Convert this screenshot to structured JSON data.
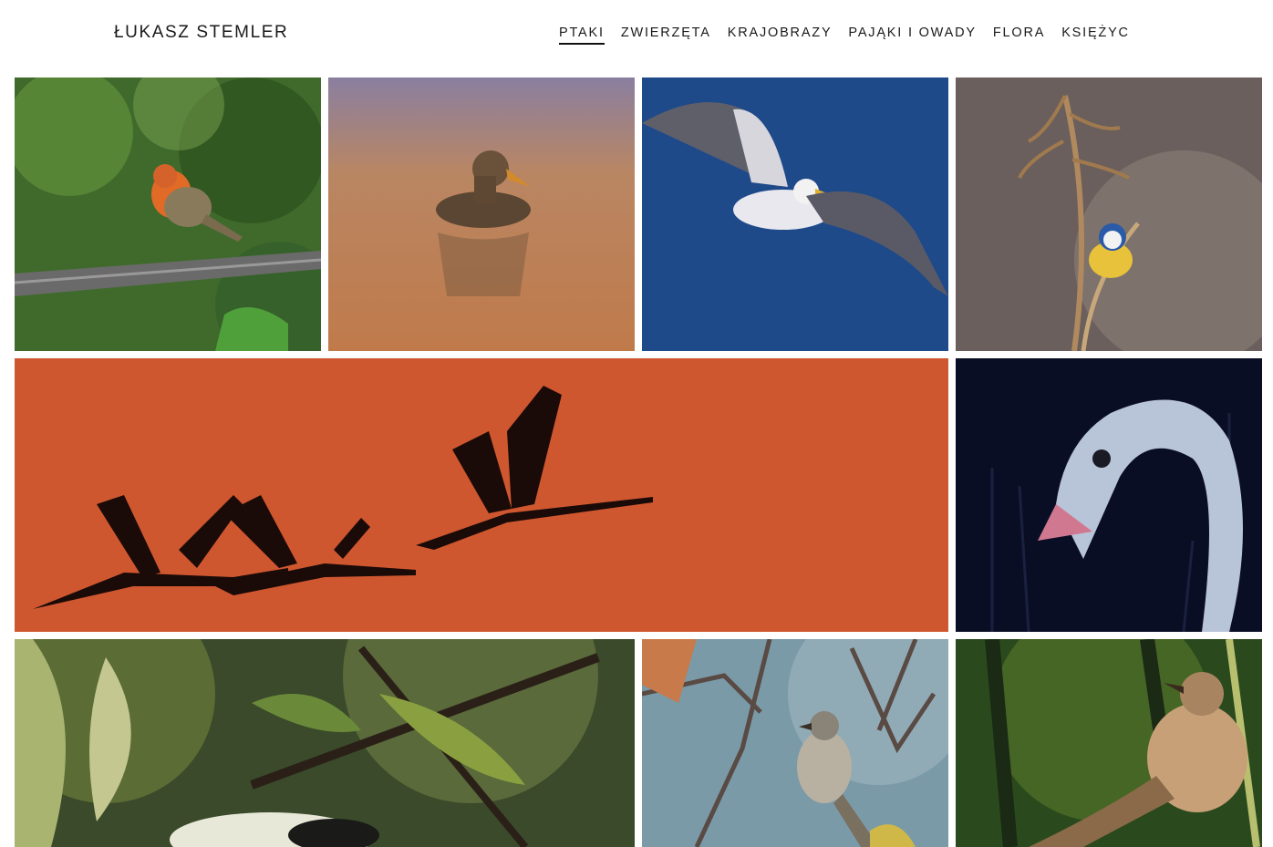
{
  "site": {
    "title": "ŁUKASZ STEMLER"
  },
  "nav": {
    "items": [
      {
        "label": "PTAKI",
        "active": true
      },
      {
        "label": "ZWIERZĘTA"
      },
      {
        "label": "KRAJOBRAZY"
      },
      {
        "label": "PAJĄKI I OWADY"
      },
      {
        "label": "FLORA"
      },
      {
        "label": "KSIĘŻYC"
      }
    ]
  },
  "gallery": {
    "photos": [
      {
        "subject": "robin on branch"
      },
      {
        "subject": "duck on water"
      },
      {
        "subject": "gull in flight"
      },
      {
        "subject": "blue tit on reed"
      },
      {
        "subject": "cranes at sunset"
      },
      {
        "subject": "swan drinking"
      },
      {
        "subject": "great tit among leaves"
      },
      {
        "subject": "whitethroat on twig"
      },
      {
        "subject": "reed warbler"
      }
    ]
  }
}
